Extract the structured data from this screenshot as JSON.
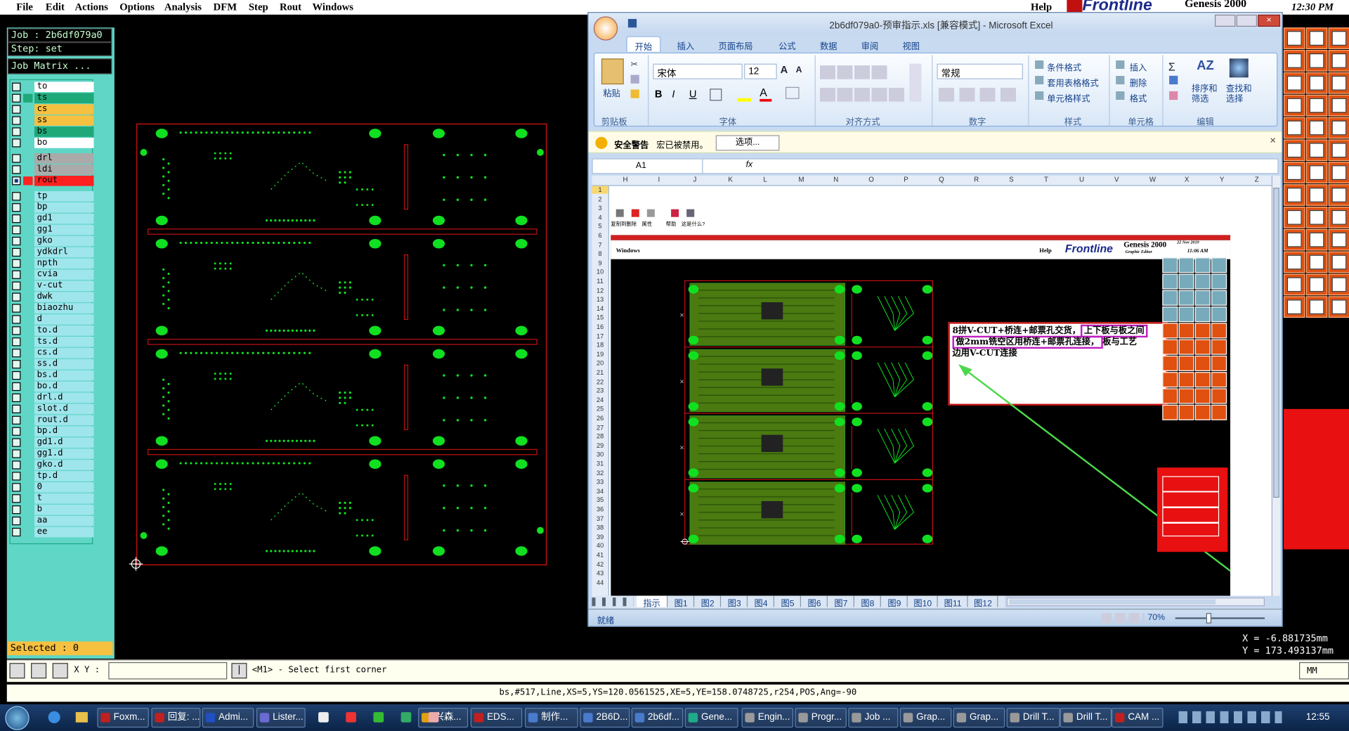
{
  "genesis_menu": {
    "items": [
      "File",
      "Edit",
      "Actions",
      "Options",
      "Analysis",
      "DFM",
      "Step",
      "Rout",
      "Windows"
    ],
    "help": "Help",
    "brand": "Frontline",
    "product": "Genesis 2000",
    "clock": "12:30 PM"
  },
  "job": {
    "label": "Job : 2b6df079a0",
    "step": "Step: set",
    "matrix_button": "Job Matrix ..."
  },
  "layers": [
    {
      "name": "to",
      "color": "#ffffff",
      "hl": false
    },
    {
      "name": "ts",
      "color": "#1fa878",
      "hl": true
    },
    {
      "name": "cs",
      "color": "#f6c040",
      "hl": false
    },
    {
      "name": "ss",
      "color": "#f6c040",
      "hl": false
    },
    {
      "name": "bs",
      "color": "#1fa878",
      "hl": false
    },
    {
      "name": "bo",
      "color": "#ffffff",
      "hl": false
    },
    {
      "name": "drl",
      "color": "#aaaaaa",
      "hl": false
    },
    {
      "name": "ldi",
      "color": "#aaaaaa",
      "hl": false
    },
    {
      "name": "rout",
      "color": "#ff2020",
      "hl": true
    },
    {
      "name": "tp",
      "color": "#9fe5ec",
      "hl": false
    },
    {
      "name": "bp",
      "color": "#9fe5ec",
      "hl": false
    },
    {
      "name": "gd1",
      "color": "#9fe5ec",
      "hl": false
    },
    {
      "name": "gg1",
      "color": "#9fe5ec",
      "hl": false
    },
    {
      "name": "gko",
      "color": "#9fe5ec",
      "hl": false
    },
    {
      "name": "ydkdrl",
      "color": "#9fe5ec",
      "hl": false
    },
    {
      "name": "npth",
      "color": "#9fe5ec",
      "hl": false
    },
    {
      "name": "cvia",
      "color": "#9fe5ec",
      "hl": false
    },
    {
      "name": "v-cut",
      "color": "#9fe5ec",
      "hl": false
    },
    {
      "name": "dwk",
      "color": "#9fe5ec",
      "hl": false
    },
    {
      "name": "biaozhu",
      "color": "#9fe5ec",
      "hl": false
    },
    {
      "name": "d",
      "color": "#9fe5ec",
      "hl": false
    },
    {
      "name": "to.d",
      "color": "#9fe5ec",
      "hl": false
    },
    {
      "name": "ts.d",
      "color": "#9fe5ec",
      "hl": false
    },
    {
      "name": "cs.d",
      "color": "#9fe5ec",
      "hl": false
    },
    {
      "name": "ss.d",
      "color": "#9fe5ec",
      "hl": false
    },
    {
      "name": "bs.d",
      "color": "#9fe5ec",
      "hl": false
    },
    {
      "name": "bo.d",
      "color": "#9fe5ec",
      "hl": false
    },
    {
      "name": "drl.d",
      "color": "#9fe5ec",
      "hl": false
    },
    {
      "name": "slot.d",
      "color": "#9fe5ec",
      "hl": false
    },
    {
      "name": "rout.d",
      "color": "#9fe5ec",
      "hl": false
    },
    {
      "name": "bp.d",
      "color": "#9fe5ec",
      "hl": false
    },
    {
      "name": "gd1.d",
      "color": "#9fe5ec",
      "hl": false
    },
    {
      "name": "gg1.d",
      "color": "#9fe5ec",
      "hl": false
    },
    {
      "name": "gko.d",
      "color": "#9fe5ec",
      "hl": false
    },
    {
      "name": "tp.d",
      "color": "#9fe5ec",
      "hl": false
    },
    {
      "name": "0",
      "color": "#9fe5ec",
      "hl": false
    },
    {
      "name": "t",
      "color": "#9fe5ec",
      "hl": false
    },
    {
      "name": "b",
      "color": "#9fe5ec",
      "hl": false
    },
    {
      "name": "aa",
      "color": "#9fe5ec",
      "hl": false
    },
    {
      "name": "ee",
      "color": "#9fe5ec",
      "hl": false
    }
  ],
  "selected": "Selected : 0",
  "command": {
    "xy_label": "X Y :",
    "prompt": "<M1> - Select first corner",
    "mode": "MM"
  },
  "coords": {
    "x": "X = -6.881735mm",
    "y": "Y = 173.493137mm"
  },
  "status_line": "bs,#517,Line,XS=5,YS=120.0561525,XE=5,YE=158.0748725,r254,POS,Ang=-90",
  "excel": {
    "title": "2b6df079a0-预审指示.xls [兼容模式] - Microsoft Excel",
    "tabs": [
      "开始",
      "插入",
      "页面布局",
      "公式",
      "数据",
      "审阅",
      "视图"
    ],
    "font_name": "宋体",
    "font_size": "12",
    "number_format": "常规",
    "groups": [
      "剪贴板",
      "字体",
      "对齐方式",
      "数字",
      "样式",
      "单元格",
      "编辑"
    ],
    "paste": "粘贴",
    "styles": [
      "条件格式",
      "套用表格格式",
      "单元格样式"
    ],
    "cells_ops": [
      "插入",
      "删除",
      "格式"
    ],
    "edit_ops": [
      "排序和筛选",
      "查找和选择"
    ],
    "security_label": "安全警告",
    "security_text": "宏已被禁用。",
    "options_button": "选项...",
    "name_box": "A1",
    "fx": "fx",
    "columns": [
      "H",
      "I",
      "J",
      "K",
      "L",
      "M",
      "N",
      "O",
      "P",
      "Q",
      "R",
      "S",
      "T",
      "U",
      "V",
      "W",
      "X",
      "Y",
      "Z"
    ],
    "rows": [
      "1",
      "2",
      "3",
      "4",
      "5",
      "6",
      "7",
      "8",
      "9",
      "10",
      "11",
      "12",
      "13",
      "14",
      "15",
      "16",
      "17",
      "18",
      "19",
      "20",
      "21",
      "22",
      "23",
      "24",
      "25",
      "26",
      "27",
      "28",
      "29",
      "30",
      "31",
      "32",
      "33",
      "34",
      "35",
      "36",
      "37",
      "38",
      "39",
      "40",
      "41",
      "42",
      "43",
      "44"
    ],
    "mini_toolbar": [
      "复制到",
      "删除",
      "属性",
      "帮助",
      "这是什么?"
    ],
    "sheet_tabs": [
      "指示",
      "图1",
      "图2",
      "图3",
      "图4",
      "图5",
      "图6",
      "图7",
      "图8",
      "图9",
      "图10",
      "图11",
      "图12"
    ],
    "status": "就绪",
    "zoom": "70%",
    "embedded": {
      "menu": "Windows",
      "help": "Help",
      "brand": "Frontline",
      "product": "Genesis 2000",
      "date": "22 Nov 2019",
      "time": "11:06 AM",
      "sub": "Graphic Editor",
      "note_line1a": "8拼V-CUT+桥连+邮票孔交货，",
      "note_line1b": "上下板与板之间",
      "note_line2a": "做2mm铣空区用桥连+邮票孔连接，",
      "note_line2b": "板与工艺",
      "note_line3": "边用V-CUT连接"
    }
  },
  "taskbar": {
    "items": [
      "Foxm...",
      "回复: ...",
      "Admi...",
      "Lister...",
      "兴森...",
      "EDS...",
      "制作...",
      "2B6D...",
      "2b6df...",
      "Gene...",
      "Engin...",
      "Progr...",
      "Job ...",
      "Grap...",
      "Grap...",
      "Drill T...",
      "Drill T...",
      "CAM ..."
    ],
    "time": "12:55"
  }
}
